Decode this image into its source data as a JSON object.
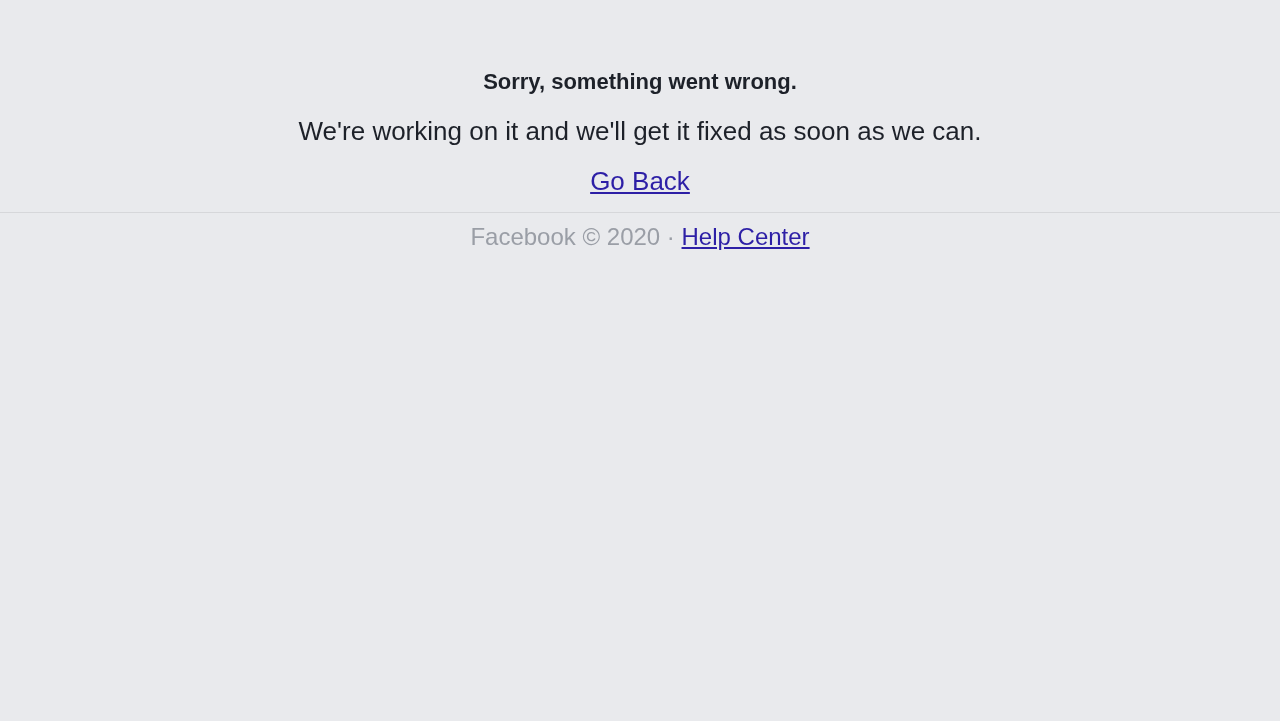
{
  "error": {
    "title": "Sorry, something went wrong.",
    "message": "We're working on it and we'll get it fixed as soon as we can.",
    "link": "Go Back"
  },
  "footer": {
    "text": "Facebook © 2020 · ",
    "link": "Help Center"
  }
}
